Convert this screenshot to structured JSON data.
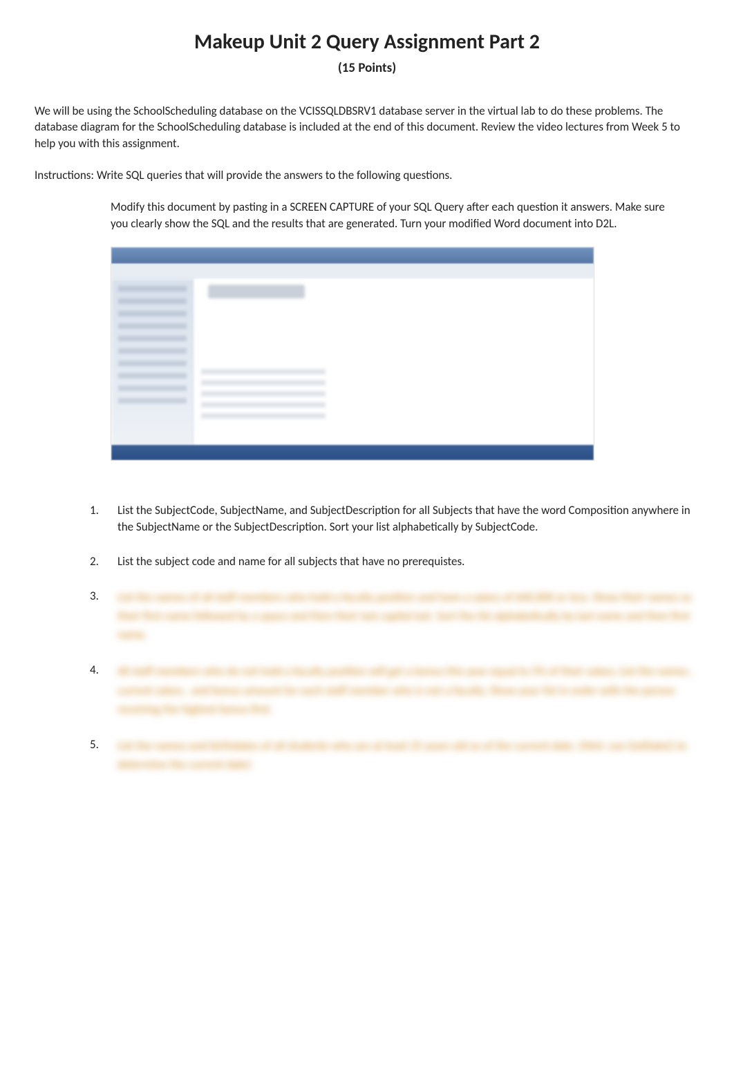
{
  "title": "Makeup Unit 2 Query Assignment Part 2",
  "subtitle": "(15 Points)",
  "intro": "We will be using the SchoolScheduling database on the VCISSQLDBSRV1 database server in the virtual lab to do these problems.  The database diagram for the SchoolScheduling database is included at the end of this document.  Review the video lectures from Week 5 to help you with this assignment.",
  "instructions_line": "Instructions: Write SQL queries that will provide the answers to the following questions.",
  "indented_note": "Modify this document by pasting in a SCREEN CAPTURE of your SQL Query after each question it answers.  Make sure you clearly show the SQL and the results that are generated.  Turn your modified Word document into D2L.",
  "questions": [
    "List the SubjectCode, SubjectName, and SubjectDescription for all Subjects that have the word Composition anywhere in the SubjectName or the SubjectDescription.  Sort your list alphabetically by SubjectCode.",
    "List the subject code and name for all subjects that have no prerequistes.",
    "List the names of all staff members  who hold a faculty position and have a salary of $40,000 or less.   Show their names as their first name  followed by a space  and then their last capital last.  Sort the list alphabetically by last name and then first name.",
    "All staff members  who do not hold a faculty position  will get a bonus this year equal to 5% of their salary.    List the names , current salary , and bonus amount for each staff member who is not a faculty.    Show your list in order with the person receiving the highest bonus first.",
    "List the names and birthdates of all students who are at least 25 years old as of the current date.    (Hint:  use GetDate() to determine the current date)"
  ]
}
